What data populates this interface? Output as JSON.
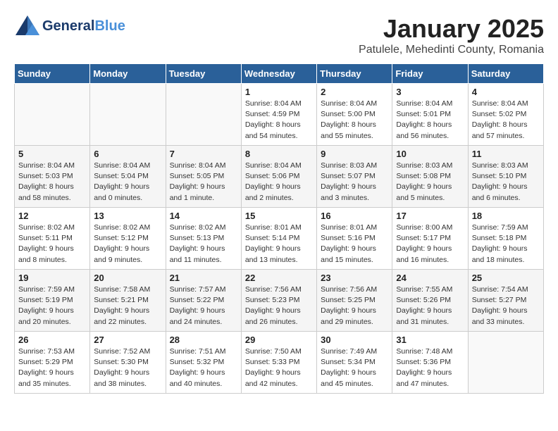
{
  "logo": {
    "line1": "General",
    "line2": "Blue",
    "tagline": ""
  },
  "title": "January 2025",
  "subtitle": "Patulele, Mehedinti County, Romania",
  "days_of_week": [
    "Sunday",
    "Monday",
    "Tuesday",
    "Wednesday",
    "Thursday",
    "Friday",
    "Saturday"
  ],
  "weeks": [
    {
      "cells": [
        {
          "day": "",
          "info": ""
        },
        {
          "day": "",
          "info": ""
        },
        {
          "day": "",
          "info": ""
        },
        {
          "day": "1",
          "info": "Sunrise: 8:04 AM\nSunset: 4:59 PM\nDaylight: 8 hours\nand 54 minutes."
        },
        {
          "day": "2",
          "info": "Sunrise: 8:04 AM\nSunset: 5:00 PM\nDaylight: 8 hours\nand 55 minutes."
        },
        {
          "day": "3",
          "info": "Sunrise: 8:04 AM\nSunset: 5:01 PM\nDaylight: 8 hours\nand 56 minutes."
        },
        {
          "day": "4",
          "info": "Sunrise: 8:04 AM\nSunset: 5:02 PM\nDaylight: 8 hours\nand 57 minutes."
        }
      ]
    },
    {
      "cells": [
        {
          "day": "5",
          "info": "Sunrise: 8:04 AM\nSunset: 5:03 PM\nDaylight: 8 hours\nand 58 minutes."
        },
        {
          "day": "6",
          "info": "Sunrise: 8:04 AM\nSunset: 5:04 PM\nDaylight: 9 hours\nand 0 minutes."
        },
        {
          "day": "7",
          "info": "Sunrise: 8:04 AM\nSunset: 5:05 PM\nDaylight: 9 hours\nand 1 minute."
        },
        {
          "day": "8",
          "info": "Sunrise: 8:04 AM\nSunset: 5:06 PM\nDaylight: 9 hours\nand 2 minutes."
        },
        {
          "day": "9",
          "info": "Sunrise: 8:03 AM\nSunset: 5:07 PM\nDaylight: 9 hours\nand 3 minutes."
        },
        {
          "day": "10",
          "info": "Sunrise: 8:03 AM\nSunset: 5:08 PM\nDaylight: 9 hours\nand 5 minutes."
        },
        {
          "day": "11",
          "info": "Sunrise: 8:03 AM\nSunset: 5:10 PM\nDaylight: 9 hours\nand 6 minutes."
        }
      ]
    },
    {
      "cells": [
        {
          "day": "12",
          "info": "Sunrise: 8:02 AM\nSunset: 5:11 PM\nDaylight: 9 hours\nand 8 minutes."
        },
        {
          "day": "13",
          "info": "Sunrise: 8:02 AM\nSunset: 5:12 PM\nDaylight: 9 hours\nand 9 minutes."
        },
        {
          "day": "14",
          "info": "Sunrise: 8:02 AM\nSunset: 5:13 PM\nDaylight: 9 hours\nand 11 minutes."
        },
        {
          "day": "15",
          "info": "Sunrise: 8:01 AM\nSunset: 5:14 PM\nDaylight: 9 hours\nand 13 minutes."
        },
        {
          "day": "16",
          "info": "Sunrise: 8:01 AM\nSunset: 5:16 PM\nDaylight: 9 hours\nand 15 minutes."
        },
        {
          "day": "17",
          "info": "Sunrise: 8:00 AM\nSunset: 5:17 PM\nDaylight: 9 hours\nand 16 minutes."
        },
        {
          "day": "18",
          "info": "Sunrise: 7:59 AM\nSunset: 5:18 PM\nDaylight: 9 hours\nand 18 minutes."
        }
      ]
    },
    {
      "cells": [
        {
          "day": "19",
          "info": "Sunrise: 7:59 AM\nSunset: 5:19 PM\nDaylight: 9 hours\nand 20 minutes."
        },
        {
          "day": "20",
          "info": "Sunrise: 7:58 AM\nSunset: 5:21 PM\nDaylight: 9 hours\nand 22 minutes."
        },
        {
          "day": "21",
          "info": "Sunrise: 7:57 AM\nSunset: 5:22 PM\nDaylight: 9 hours\nand 24 minutes."
        },
        {
          "day": "22",
          "info": "Sunrise: 7:56 AM\nSunset: 5:23 PM\nDaylight: 9 hours\nand 26 minutes."
        },
        {
          "day": "23",
          "info": "Sunrise: 7:56 AM\nSunset: 5:25 PM\nDaylight: 9 hours\nand 29 minutes."
        },
        {
          "day": "24",
          "info": "Sunrise: 7:55 AM\nSunset: 5:26 PM\nDaylight: 9 hours\nand 31 minutes."
        },
        {
          "day": "25",
          "info": "Sunrise: 7:54 AM\nSunset: 5:27 PM\nDaylight: 9 hours\nand 33 minutes."
        }
      ]
    },
    {
      "cells": [
        {
          "day": "26",
          "info": "Sunrise: 7:53 AM\nSunset: 5:29 PM\nDaylight: 9 hours\nand 35 minutes."
        },
        {
          "day": "27",
          "info": "Sunrise: 7:52 AM\nSunset: 5:30 PM\nDaylight: 9 hours\nand 38 minutes."
        },
        {
          "day": "28",
          "info": "Sunrise: 7:51 AM\nSunset: 5:32 PM\nDaylight: 9 hours\nand 40 minutes."
        },
        {
          "day": "29",
          "info": "Sunrise: 7:50 AM\nSunset: 5:33 PM\nDaylight: 9 hours\nand 42 minutes."
        },
        {
          "day": "30",
          "info": "Sunrise: 7:49 AM\nSunset: 5:34 PM\nDaylight: 9 hours\nand 45 minutes."
        },
        {
          "day": "31",
          "info": "Sunrise: 7:48 AM\nSunset: 5:36 PM\nDaylight: 9 hours\nand 47 minutes."
        },
        {
          "day": "",
          "info": ""
        }
      ]
    }
  ]
}
